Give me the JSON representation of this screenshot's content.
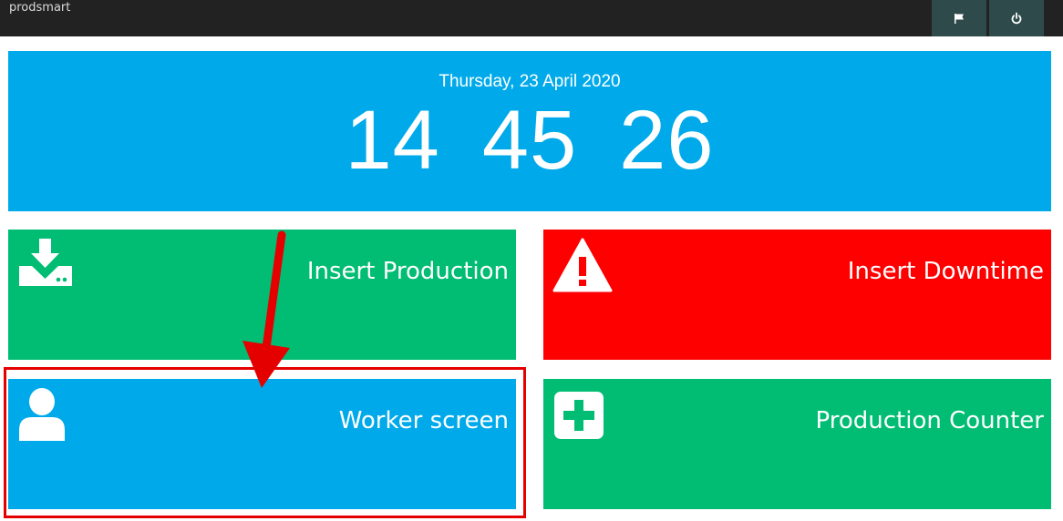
{
  "app": {
    "brand": "prodsmart",
    "icons": {
      "flag": "flag-icon",
      "power": "power-icon"
    }
  },
  "clock": {
    "date": "Thursday, 23 April 2020",
    "hours": "14",
    "minutes": "45",
    "seconds": "26"
  },
  "tiles": {
    "insert_production": {
      "label": "Insert Production",
      "icon": "download-drive-icon",
      "color": "#00bd73"
    },
    "insert_downtime": {
      "label": "Insert Downtime",
      "icon": "warning-icon",
      "color": "#ff0000"
    },
    "worker_screen": {
      "label": "Worker screen",
      "icon": "user-icon",
      "color": "#00aaea"
    },
    "production_counter": {
      "label": "Production Counter",
      "icon": "plus-square-icon",
      "color": "#00bd73"
    }
  },
  "annotation": {
    "color": "#e50000"
  }
}
